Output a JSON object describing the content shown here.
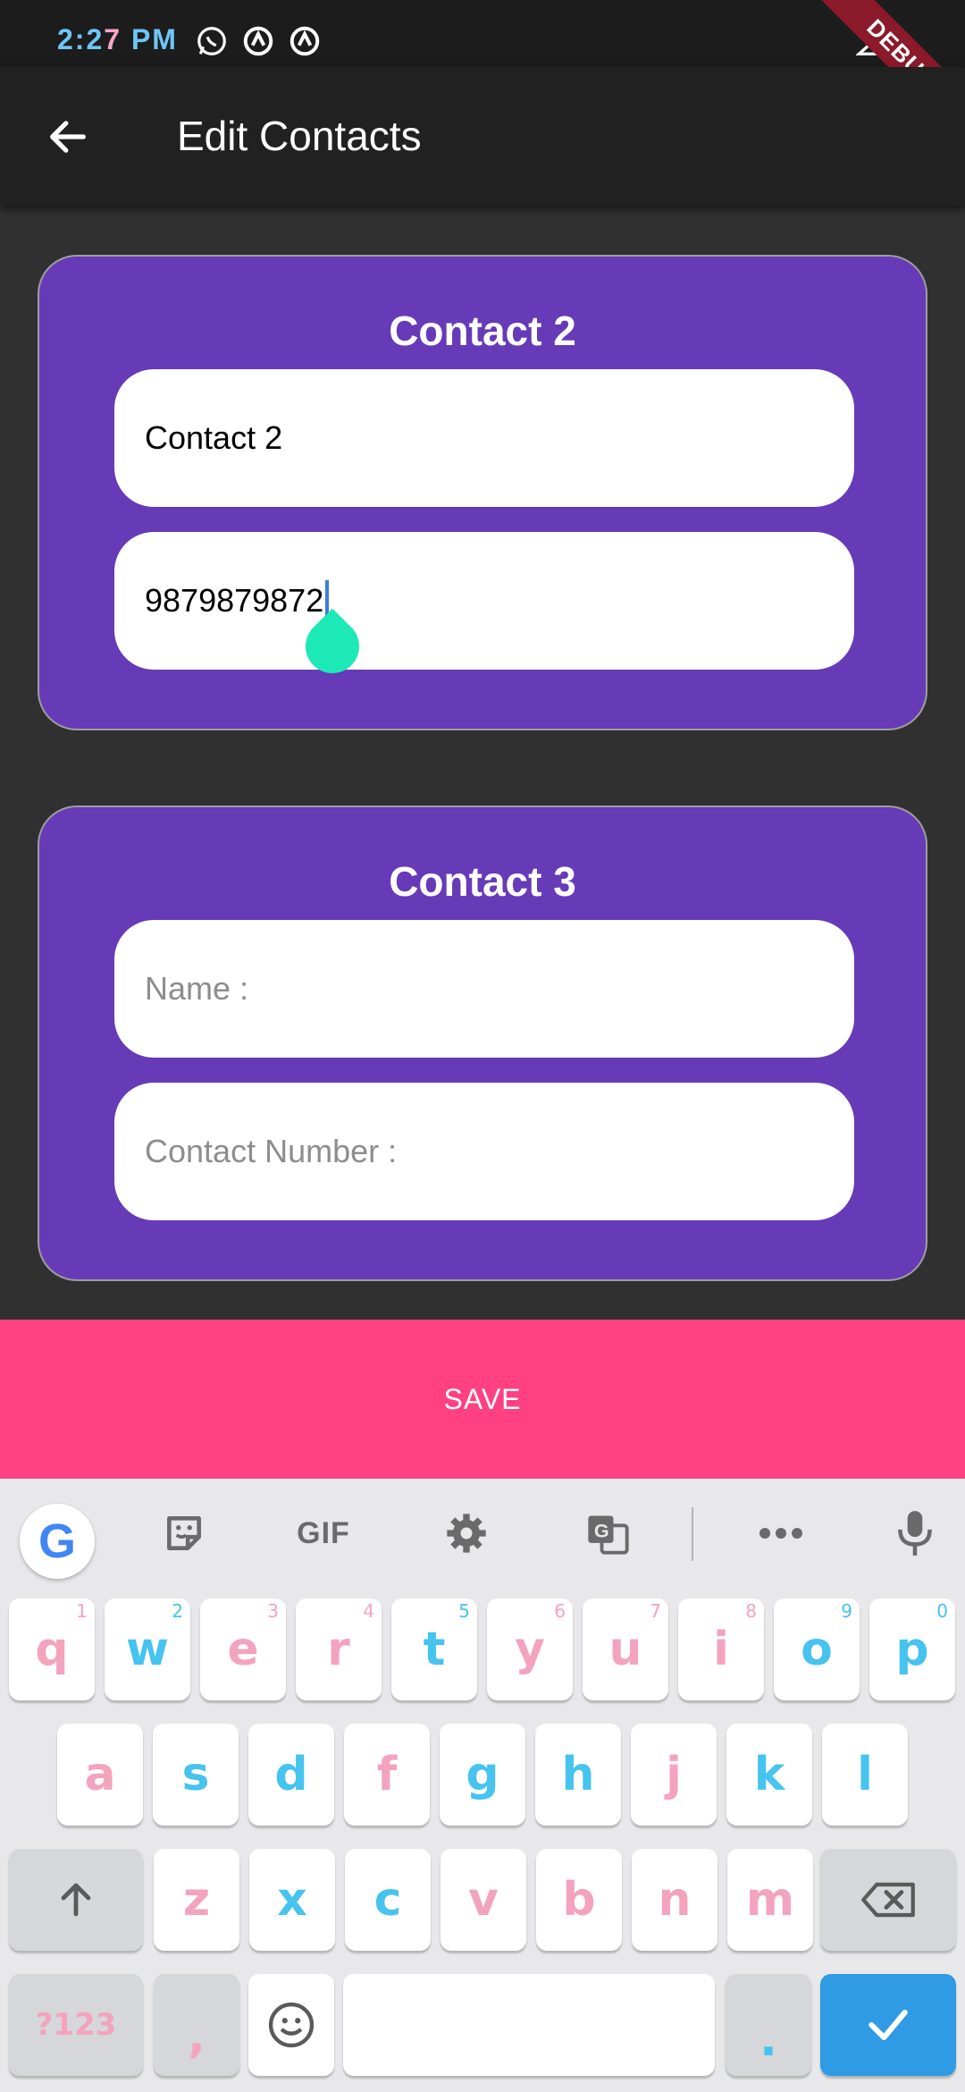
{
  "status_bar": {
    "time_part1": "2:2",
    "time_part2": "7",
    "time_part3": " PM",
    "icons": [
      "whatsapp-icon",
      "notification-icon",
      "notification-icon"
    ],
    "debug_label": "DEBUG"
  },
  "app_bar": {
    "title": "Edit Contacts",
    "back_icon": "back-arrow-icon"
  },
  "contacts": [
    {
      "title": "Contact 2",
      "name_value": "Contact 2",
      "number_value": "9879879872"
    },
    {
      "title": "Contact 3",
      "name_placeholder": "Name :",
      "number_placeholder": "Contact Number :"
    }
  ],
  "save_label": "SAVE",
  "keyboard": {
    "toolbar": {
      "google_label": "G",
      "gif_label": "GIF",
      "icons": [
        "google-icon",
        "sticker-icon",
        "gif-icon",
        "settings-icon",
        "translate-icon",
        "more-icon",
        "mic-icon"
      ]
    },
    "row1": [
      {
        "k": "q",
        "h": "1",
        "c": "pink"
      },
      {
        "k": "w",
        "h": "2",
        "c": "blue"
      },
      {
        "k": "e",
        "h": "3",
        "c": "pink"
      },
      {
        "k": "r",
        "h": "4",
        "c": "pink"
      },
      {
        "k": "t",
        "h": "5",
        "c": "blue"
      },
      {
        "k": "y",
        "h": "6",
        "c": "pink"
      },
      {
        "k": "u",
        "h": "7",
        "c": "pink"
      },
      {
        "k": "i",
        "h": "8",
        "c": "pink"
      },
      {
        "k": "o",
        "h": "9",
        "c": "blue"
      },
      {
        "k": "p",
        "h": "0",
        "c": "blue"
      }
    ],
    "row2": [
      {
        "k": "a",
        "c": "pink"
      },
      {
        "k": "s",
        "c": "blue"
      },
      {
        "k": "d",
        "c": "blue"
      },
      {
        "k": "f",
        "c": "pink"
      },
      {
        "k": "g",
        "c": "blue"
      },
      {
        "k": "h",
        "c": "blue"
      },
      {
        "k": "j",
        "c": "pink"
      },
      {
        "k": "k",
        "c": "blue"
      },
      {
        "k": "l",
        "c": "blue"
      }
    ],
    "row3": [
      {
        "k": "z",
        "c": "pink"
      },
      {
        "k": "x",
        "c": "blue"
      },
      {
        "k": "c",
        "c": "blue"
      },
      {
        "k": "v",
        "c": "pink"
      },
      {
        "k": "b",
        "c": "pink"
      },
      {
        "k": "n",
        "c": "pink"
      },
      {
        "k": "m",
        "c": "pink"
      }
    ],
    "symbols_label": "?123",
    "comma_label": ",",
    "period_label": ".",
    "colors": {
      "pink": "#f4a3bd",
      "blue": "#46c3ef",
      "enter": "#2f9be5"
    }
  },
  "colors": {
    "card": "#673ab7",
    "save": "#ff4081",
    "background": "#303030",
    "app_bar": "#212121"
  }
}
